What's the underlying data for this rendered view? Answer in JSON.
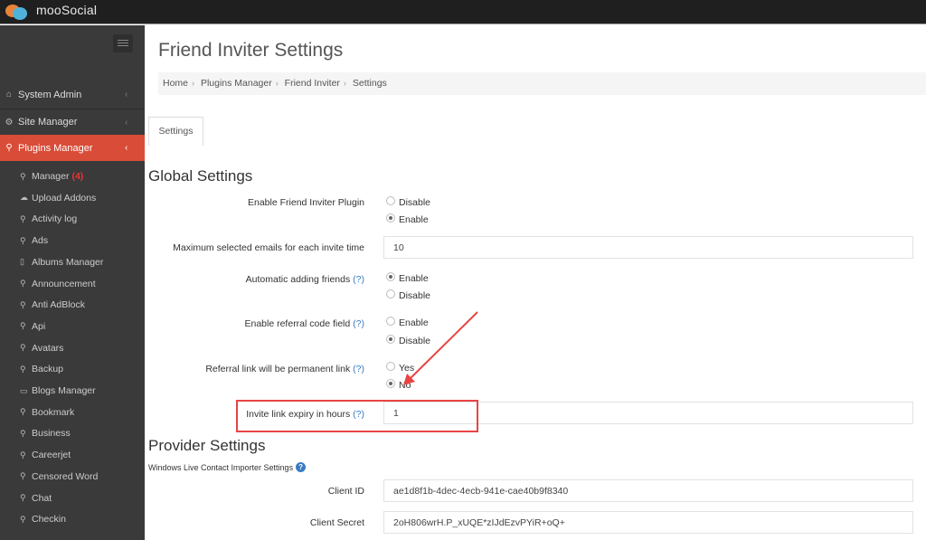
{
  "app": {
    "brand": "mooSocial"
  },
  "sidebar": {
    "main_items": [
      {
        "label": "System Admin",
        "icon": "home-icon"
      },
      {
        "label": "Site Manager",
        "icon": "gears-icon"
      },
      {
        "label": "Plugins Manager",
        "icon": "plug-icon",
        "active": true
      }
    ],
    "sub_items": [
      {
        "label": "Manager",
        "badge": "(4)",
        "icon": "plug-icon"
      },
      {
        "label": "Upload Addons",
        "icon": "cloud-upload-icon"
      },
      {
        "label": "Activity log",
        "icon": "plug-icon"
      },
      {
        "label": "Ads",
        "icon": "plug-icon"
      },
      {
        "label": "Albums Manager",
        "icon": "album-icon"
      },
      {
        "label": "Announcement",
        "icon": "plug-icon"
      },
      {
        "label": "Anti AdBlock",
        "icon": "plug-icon"
      },
      {
        "label": "Api",
        "icon": "plug-icon"
      },
      {
        "label": "Avatars",
        "icon": "plug-icon"
      },
      {
        "label": "Backup",
        "icon": "plug-icon"
      },
      {
        "label": "Blogs Manager",
        "icon": "comment-icon"
      },
      {
        "label": "Bookmark",
        "icon": "plug-icon"
      },
      {
        "label": "Business",
        "icon": "plug-icon"
      },
      {
        "label": "Careerjet",
        "icon": "plug-icon"
      },
      {
        "label": "Censored Word",
        "icon": "plug-icon"
      },
      {
        "label": "Chat",
        "icon": "plug-icon"
      },
      {
        "label": "Checkin",
        "icon": "plug-icon"
      }
    ]
  },
  "page": {
    "title": "Friend Inviter Settings",
    "breadcrumb": [
      "Home",
      "Plugins Manager",
      "Friend Inviter",
      "Settings"
    ],
    "tabs": [
      {
        "label": "Settings",
        "active": true
      }
    ]
  },
  "global_settings": {
    "title": "Global Settings",
    "enable_plugin": {
      "label": "Enable Friend Inviter Plugin",
      "options": [
        "Disable",
        "Enable"
      ],
      "selected": "Enable"
    },
    "max_emails": {
      "label": "Maximum selected emails for each invite time",
      "value": "10"
    },
    "auto_add_friends": {
      "label": "Automatic adding friends",
      "help": "(?)",
      "options": [
        "Enable",
        "Disable"
      ],
      "selected": "Enable"
    },
    "referral_code": {
      "label": "Enable referral code field",
      "help": "(?)",
      "options": [
        "Enable",
        "Disable"
      ],
      "selected": "Disable"
    },
    "permanent_link": {
      "label": "Referral link will be permanent link",
      "help": "(?)",
      "options": [
        "Yes",
        "No"
      ],
      "selected": "No"
    },
    "link_expiry": {
      "label": "Invite link expiry in hours",
      "help": "(?)",
      "value": "1"
    }
  },
  "provider_settings": {
    "title": "Provider Settings",
    "windows_live": {
      "title": "Windows Live Contact Importer Settings",
      "client_id": {
        "label": "Client ID",
        "value": "ae1d8f1b-4dec-4ecb-941e-cae40b9f8340"
      },
      "client_secret": {
        "label": "Client Secret",
        "value": "2oH806wrH.P_xUQE*zIJdEzvPYiR+oQ+"
      }
    }
  },
  "annotation": {
    "color": "#e84444"
  }
}
